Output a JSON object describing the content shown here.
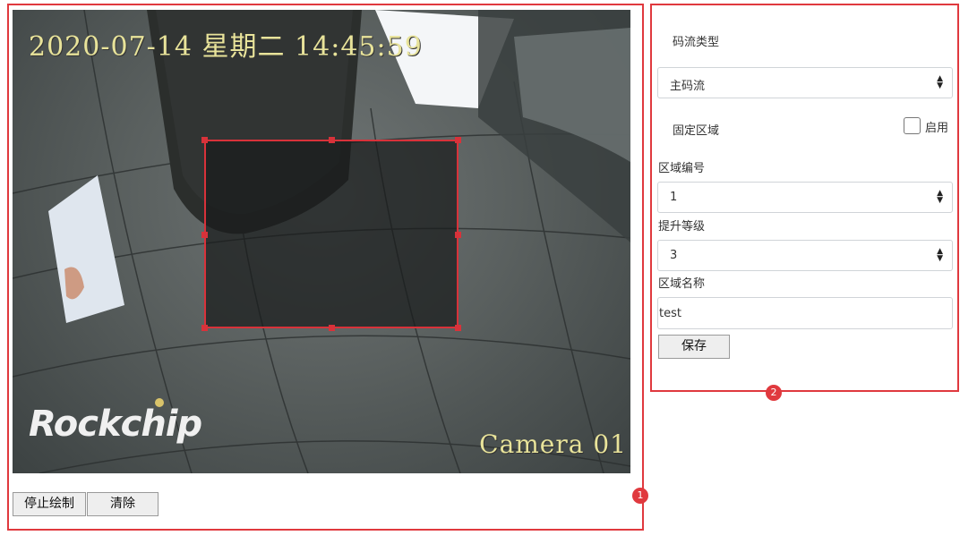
{
  "video": {
    "osd_datetime": "2020-07-14 星期二 14:45:59",
    "osd_camera": "Camera 01",
    "watermark": "Rockchip"
  },
  "controls": {
    "stop_draw_label": "停止绘制",
    "clear_label": "清除"
  },
  "panel": {
    "stream_type_label": "码流类型",
    "stream_type_value": "主码流",
    "fixed_region_label": "固定区域",
    "enable_label": "启用",
    "enable_checked": false,
    "region_number_label": "区域编号",
    "region_number_value": "1",
    "promote_level_label": "提升等级",
    "promote_level_value": "3",
    "region_name_label": "区域名称",
    "region_name_value": "test",
    "save_label": "保存"
  },
  "annotations": {
    "marker_1": "1",
    "marker_2": "2"
  },
  "colors": {
    "annotation": "#e0393e",
    "roi_border": "#d8323a",
    "osd_text": "#e8e39a"
  }
}
